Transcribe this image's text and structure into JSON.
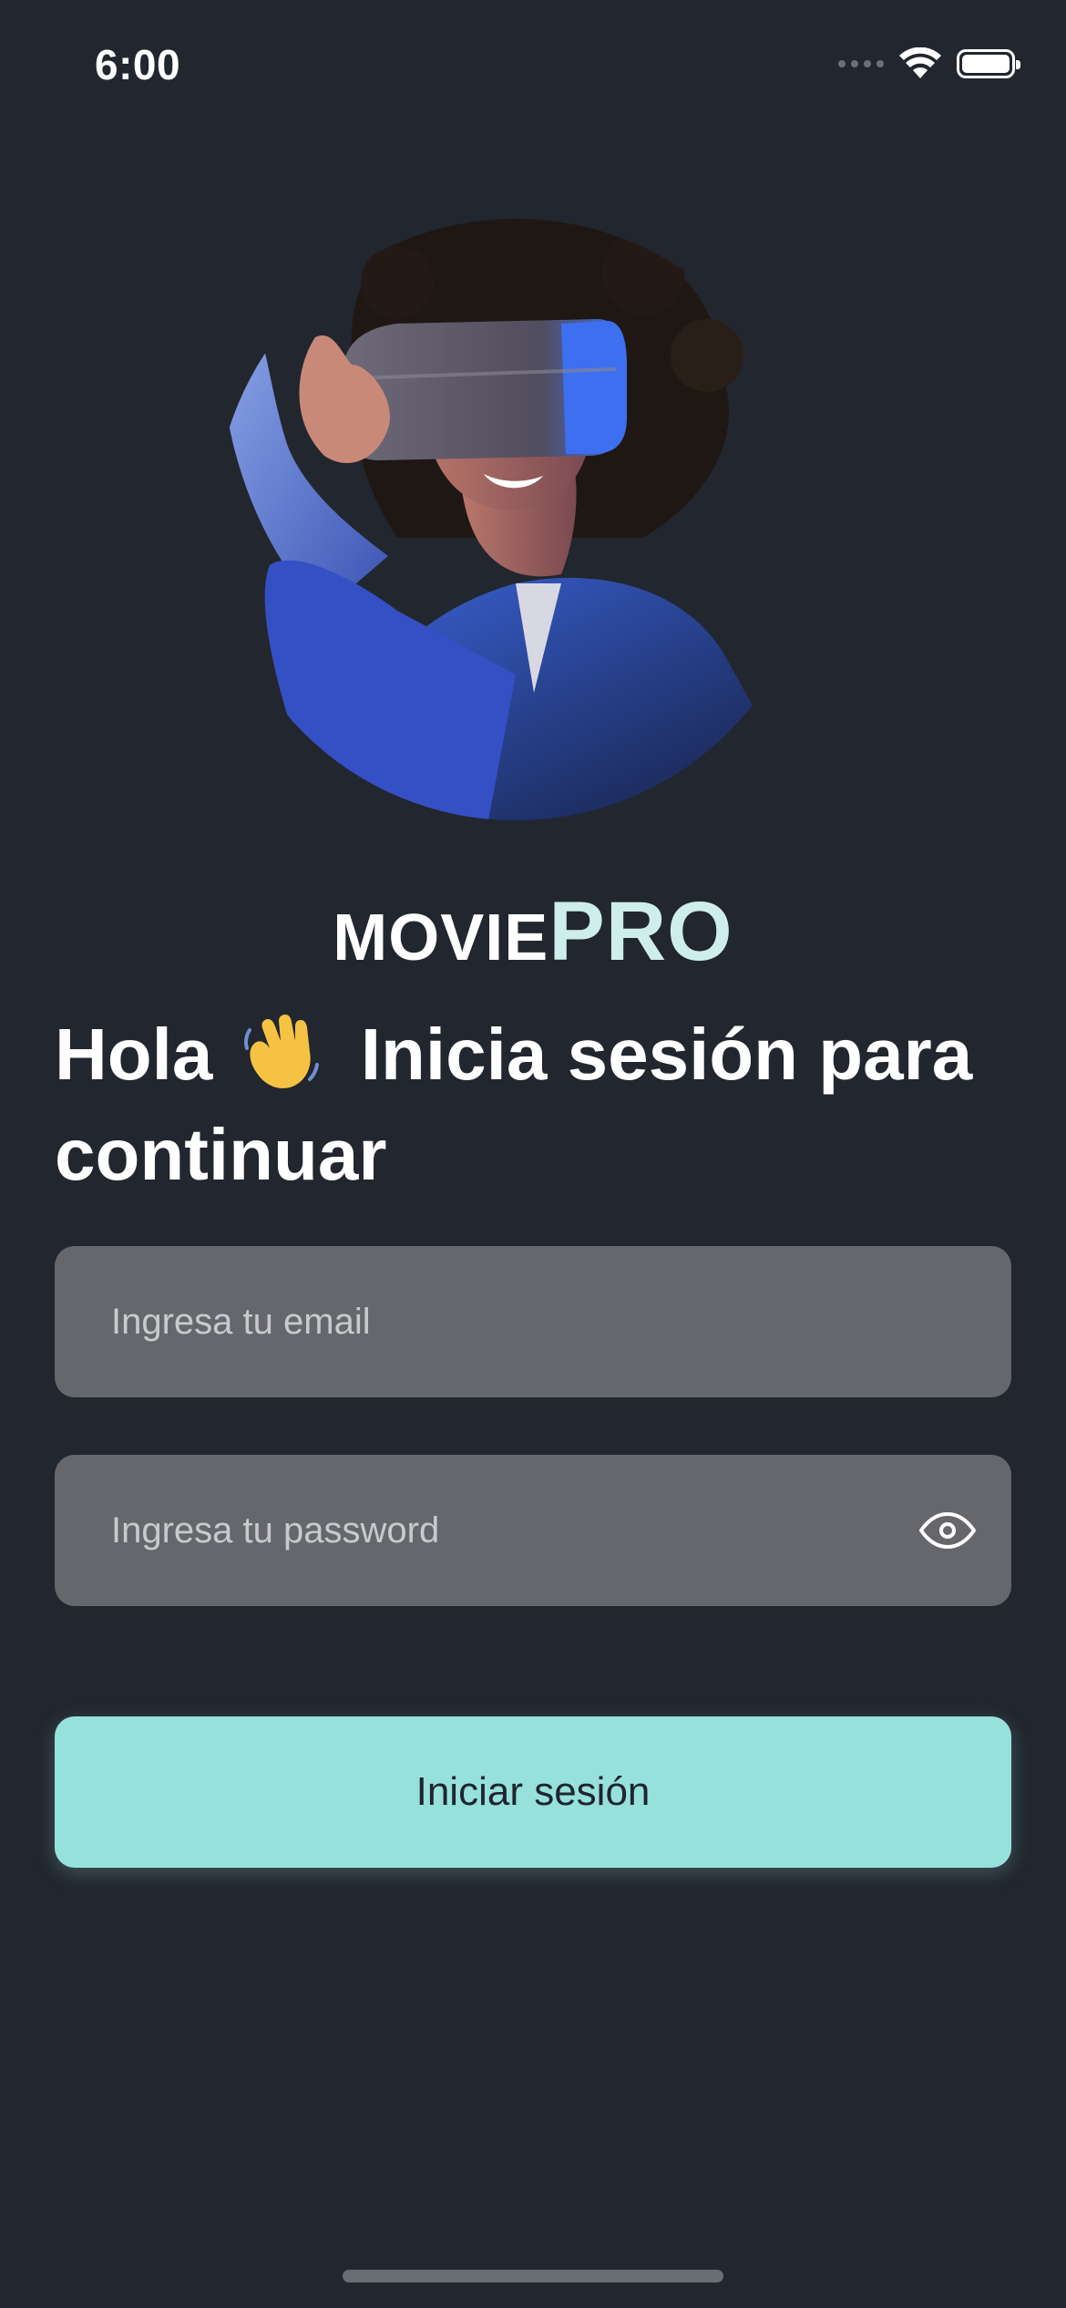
{
  "status_bar": {
    "time": "6:00",
    "icons": [
      "cellular-dots-icon",
      "wifi-icon",
      "battery-icon"
    ]
  },
  "hero": {
    "icon": "vr-headset-person-image"
  },
  "logo": {
    "movie": "MOVIE",
    "pro": "PRO",
    "accent_color": "#cdeeea"
  },
  "heading": {
    "greeting": "Hola",
    "emoji_icon": "waving-hand-icon",
    "line": "Inicia sesión para continuar"
  },
  "form": {
    "email_placeholder": "Ingresa tu email",
    "email_value": "",
    "password_placeholder": "Ingresa tu password",
    "password_value": "",
    "show_password_icon": "eye-icon"
  },
  "login_button": {
    "label": "Iniciar sesión",
    "color": "#97e1dc"
  },
  "colors": {
    "background": "#22262e",
    "field": "#66676c"
  }
}
